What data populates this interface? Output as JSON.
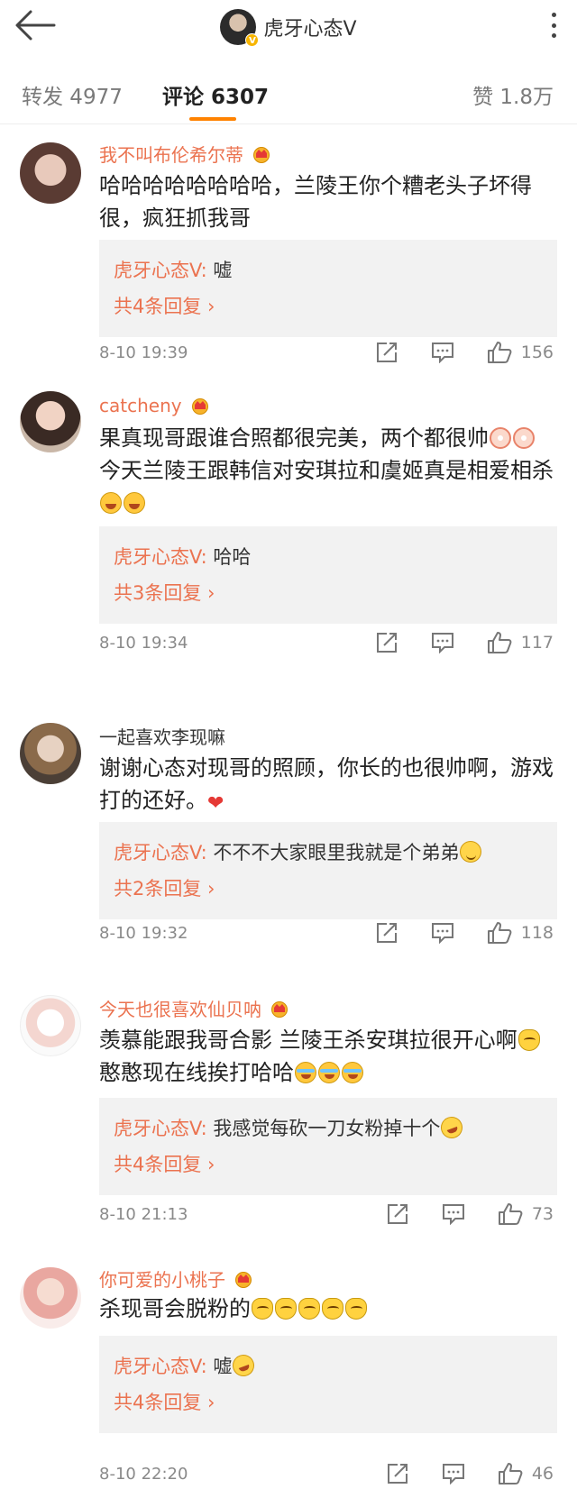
{
  "header": {
    "title": "虎牙心态V",
    "verified_badge": "V"
  },
  "tabs": {
    "repost": "转发 4977",
    "comments": "评论 6307",
    "likes": "赞 1.8万"
  },
  "comments": [
    {
      "user": "我不叫布伦希尔蒂",
      "text_a": "哈哈哈哈哈哈哈哈，兰陵王你个糟老头子坏得很，疯狂抓我哥",
      "reply_author": "虎牙心态V:",
      "reply_text": " 嘘",
      "reply_more": "共4条回复 ›",
      "time": "8-10 19:39",
      "likes": "156"
    },
    {
      "user": "catcheny",
      "text_a": "果真现哥跟谁合照都很完美，两个都很帅",
      "text_b": "今天兰陵王跟韩信对安琪拉和虞姬真是相爱相杀",
      "reply_author": "虎牙心态V:",
      "reply_text": " 哈哈",
      "reply_more": "共3条回复 ›",
      "time": "8-10 19:34",
      "likes": "117"
    },
    {
      "user": "一起喜欢李现嘛",
      "text_a": "谢谢心态对现哥的照顾，你长的也很帅啊，游戏打的还好。",
      "reply_author": "虎牙心态V:",
      "reply_text": " 不不不大家眼里我就是个弟弟",
      "reply_more": "共2条回复 ›",
      "time": "8-10 19:32",
      "likes": "118"
    },
    {
      "user": "今天也很喜欢仙贝呐",
      "text_a": "羡慕能跟我哥合影 兰陵王杀安琪拉很开心啊",
      "text_b": " 憨憨现在线挨打哈哈",
      "reply_author": "虎牙心态V:",
      "reply_text": " 我感觉每砍一刀女粉掉十个",
      "reply_more": "共4条回复 ›",
      "time": "8-10 21:13",
      "likes": "73"
    },
    {
      "user": "你可爱的小桃子",
      "text_a": "杀现哥会脱粉的",
      "reply_author": "虎牙心态V:",
      "reply_text": " 嘘",
      "reply_more": "共4条回复 ›",
      "time": "8-10 22:20",
      "likes": "46"
    }
  ],
  "colors": {
    "accent": "#ff8200",
    "username": "#eb7350",
    "reply_bg": "#f2f2f2"
  },
  "icons": [
    "back-arrow-icon",
    "more-vertical-icon",
    "crown-icon",
    "share-icon",
    "comment-icon",
    "thumbs-up-icon"
  ]
}
